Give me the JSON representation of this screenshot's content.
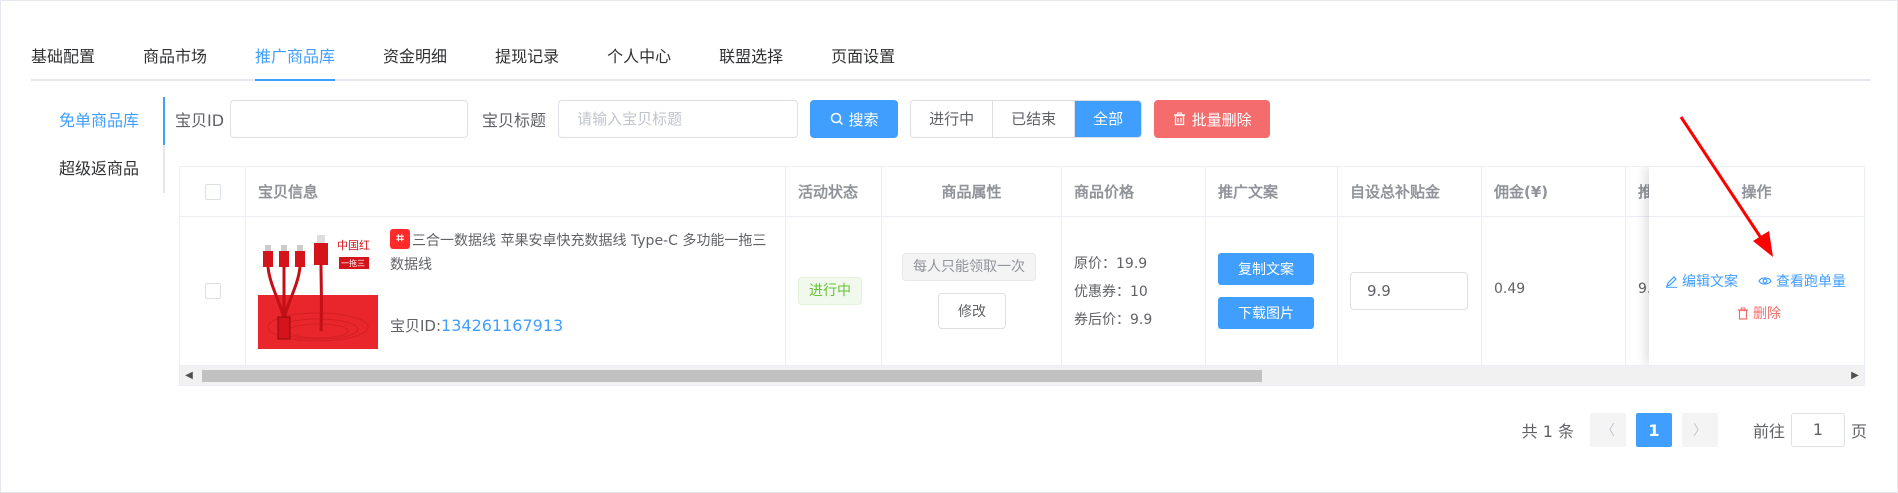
{
  "top_tabs": [
    {
      "label": "基础配置"
    },
    {
      "label": "商品市场"
    },
    {
      "label": "推广商品库"
    },
    {
      "label": "资金明细"
    },
    {
      "label": "提现记录"
    },
    {
      "label": "个人中心"
    },
    {
      "label": "联盟选择"
    },
    {
      "label": "页面设置"
    }
  ],
  "active_top_tab": "推广商品库",
  "side_menu": [
    {
      "label": "免单商品库"
    },
    {
      "label": "超级返商品"
    }
  ],
  "filter": {
    "id_label": "宝贝ID",
    "id_value": "",
    "title_label": "宝贝标题",
    "title_placeholder": "请输入宝贝标题",
    "search_label": "搜索",
    "status_options": [
      "进行中",
      "已结束",
      "全部"
    ],
    "status_selected": "全部",
    "batch_delete_label": "批量删除"
  },
  "table": {
    "columns": [
      "宝贝信息",
      "活动状态",
      "商品属性",
      "商品价格",
      "推广文案",
      "自设总补贴金",
      "佣金(¥)",
      "推",
      "操作"
    ],
    "rows": [
      {
        "badge": "tm",
        "image_brand": "中国红",
        "image_text": "一拖三",
        "title": "三合一数据线 苹果安卓快充数据线 Type-C 多功能一拖三数据线",
        "id_prefix": "宝贝ID:",
        "id": "134261167913",
        "status": "进行中",
        "attribute": "每人只能领取一次",
        "modify_label": "修改",
        "price_original": "原价：19.9",
        "price_coupon": "优惠券：10",
        "price_after": "券后价：9.9",
        "copy_btn": "复制文案",
        "download_btn": "下载图片",
        "subsidy": "9.9",
        "commission": "0.49",
        "truncated": "9.",
        "ops": {
          "edit": "编辑文案",
          "view": "查看跑单量",
          "delete": "删除"
        }
      }
    ]
  },
  "pager": {
    "total": "共 1 条",
    "current": "1",
    "goto_label": "前往",
    "goto_value": "1",
    "page_suffix": "页"
  },
  "colors": {
    "primary": "#409eff",
    "danger": "#f56c6c",
    "success": "#67c23a",
    "annotation": "#ff0000"
  }
}
